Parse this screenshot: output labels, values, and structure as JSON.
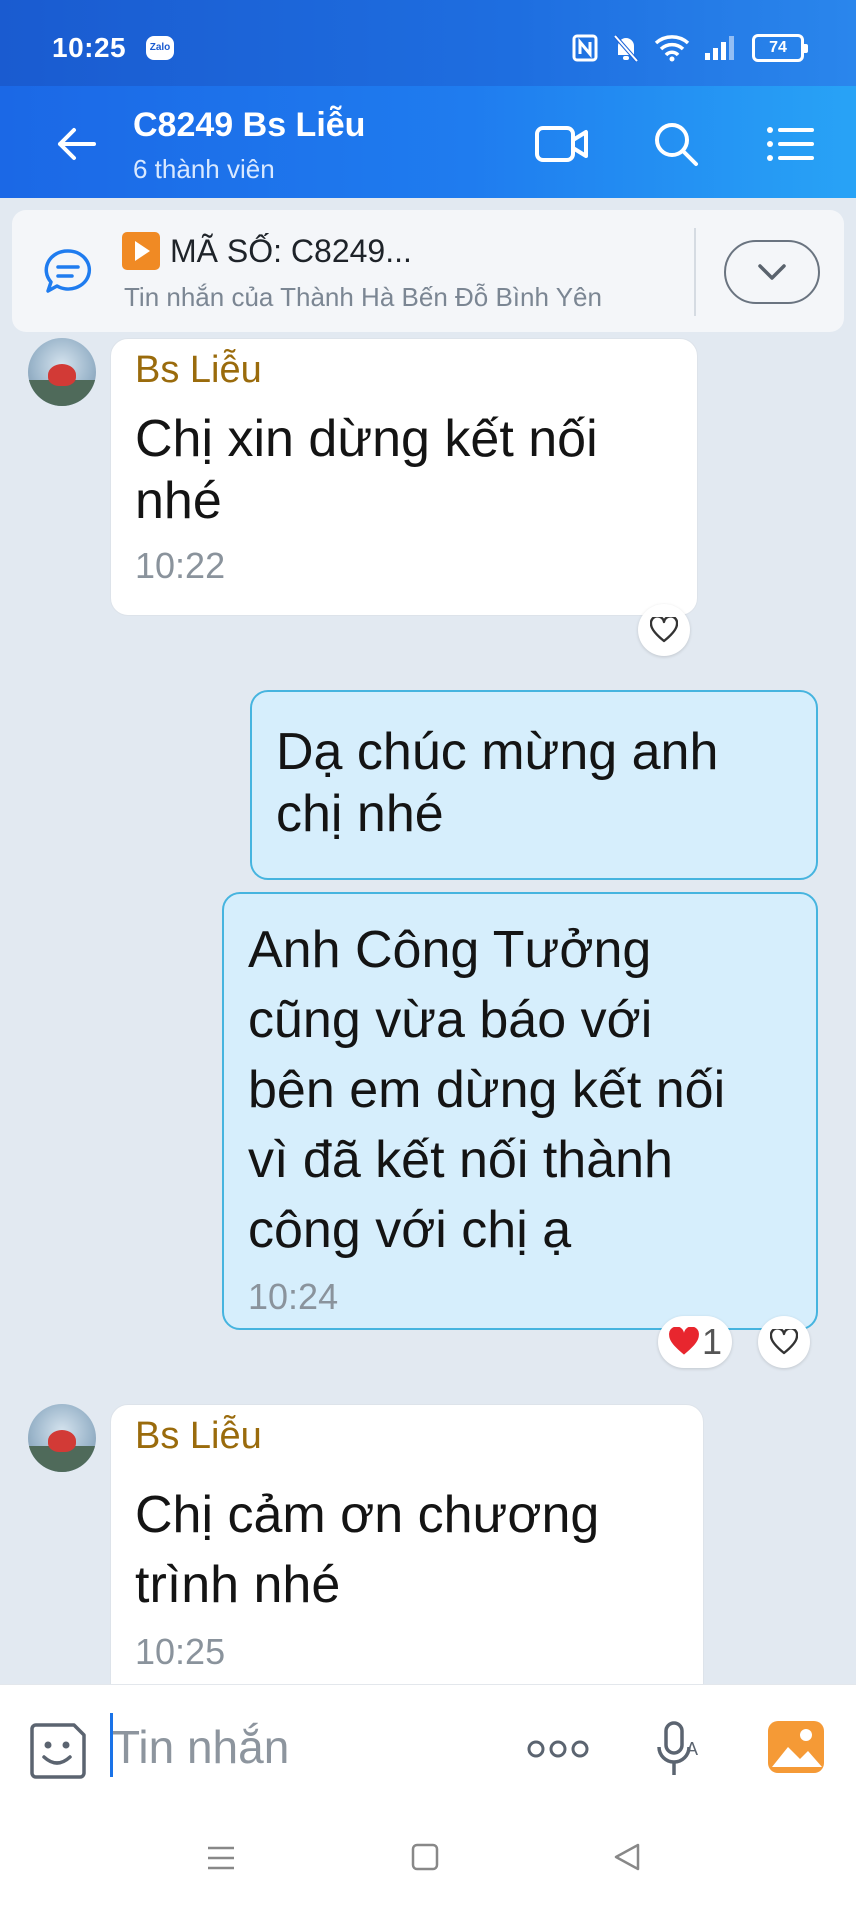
{
  "status_bar": {
    "time": "10:25",
    "app_badge": "Zalo",
    "battery": "74"
  },
  "header": {
    "title": "C8249 Bs Liễu",
    "subtitle": "6 thành viên"
  },
  "pinned": {
    "title": "MÃ SỐ: C8249...",
    "subtitle": "Tin nhắn của Thành Hà Bến Đỗ Bình Yên"
  },
  "messages": [
    {
      "sender": "Bs Liễu",
      "line1": "Chị xin dừng kết nối",
      "line2": "nhé",
      "time": "10:22"
    },
    {
      "line1": "Dạ chúc mừng anh",
      "line2": "chị nhé"
    },
    {
      "line1": "Anh Công Tưởng",
      "line2": "cũng vừa báo với",
      "line3": "bên em dừng kết nối",
      "line4": "vì đã kết nối thành",
      "line5": "công với chị ạ",
      "time": "10:24",
      "reaction_count": "1"
    },
    {
      "sender": "Bs Liễu",
      "line1": "Chị  cảm ơn chương",
      "line2": "trình nhé",
      "time": "10:25"
    }
  ],
  "composer": {
    "placeholder": "Tin nhắn"
  },
  "colors": {
    "header_blue": "#1f7cef",
    "sender_name": "#9a6b0c",
    "outgoing_bubble": "#d6eefc",
    "outgoing_border": "#46b4df"
  }
}
